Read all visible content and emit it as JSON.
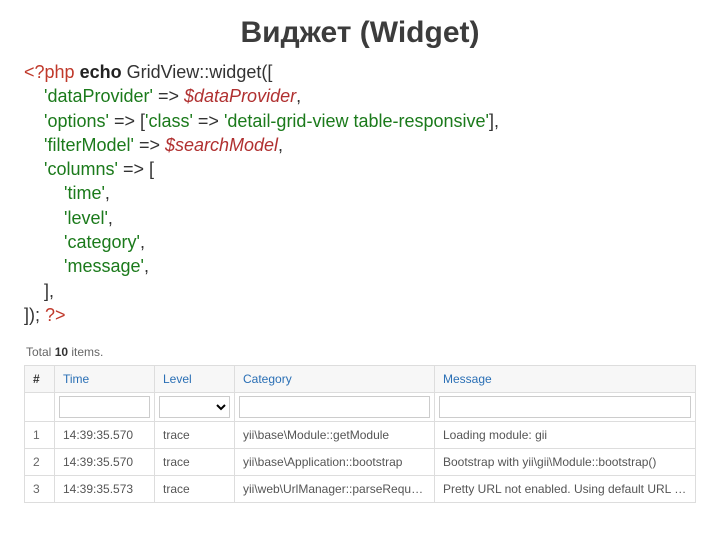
{
  "title": "Виджет (Widget)",
  "code": {
    "openTag": "<?php",
    "echoKw": "echo",
    "call": "GridView::widget([",
    "dataProviderKey": "'dataProvider'",
    "arrow": "=>",
    "dataProviderVal": "$dataProvider",
    "optionsKey": "'options'",
    "optionsOpen": "[",
    "classKey": "'class'",
    "classVal": "'detail-grid-view table-responsive'",
    "optionsClose": "],",
    "filterModelKey": "'filterModel'",
    "filterModelVal": "$searchModel",
    "columnsKey": "'columns'",
    "columnsOpen": "[",
    "col1": "'time'",
    "col2": "'level'",
    "col3": "'category'",
    "col4": "'message'",
    "columnsClose": "],",
    "callClose": "]);",
    "closeTag": "?>"
  },
  "grid": {
    "summaryPrefix": "Total ",
    "summaryCount": "10",
    "summarySuffix": " items.",
    "headers": {
      "serial": "#",
      "time": "Time",
      "level": "Level",
      "category": "Category",
      "message": "Message"
    },
    "rows": [
      {
        "n": "1",
        "time": "14:39:35.570",
        "level": "trace",
        "category": "yii\\base\\Module::getModule",
        "message": "Loading module: gii"
      },
      {
        "n": "2",
        "time": "14:39:35.570",
        "level": "trace",
        "category": "yii\\base\\Application::bootstrap",
        "message": "Bootstrap with yii\\gii\\Module::bootstrap()"
      },
      {
        "n": "3",
        "time": "14:39:35.573",
        "level": "trace",
        "category": "yii\\web\\UrlManager::parseRequest",
        "message": "Pretty URL not enabled. Using default URL pa"
      }
    ]
  }
}
